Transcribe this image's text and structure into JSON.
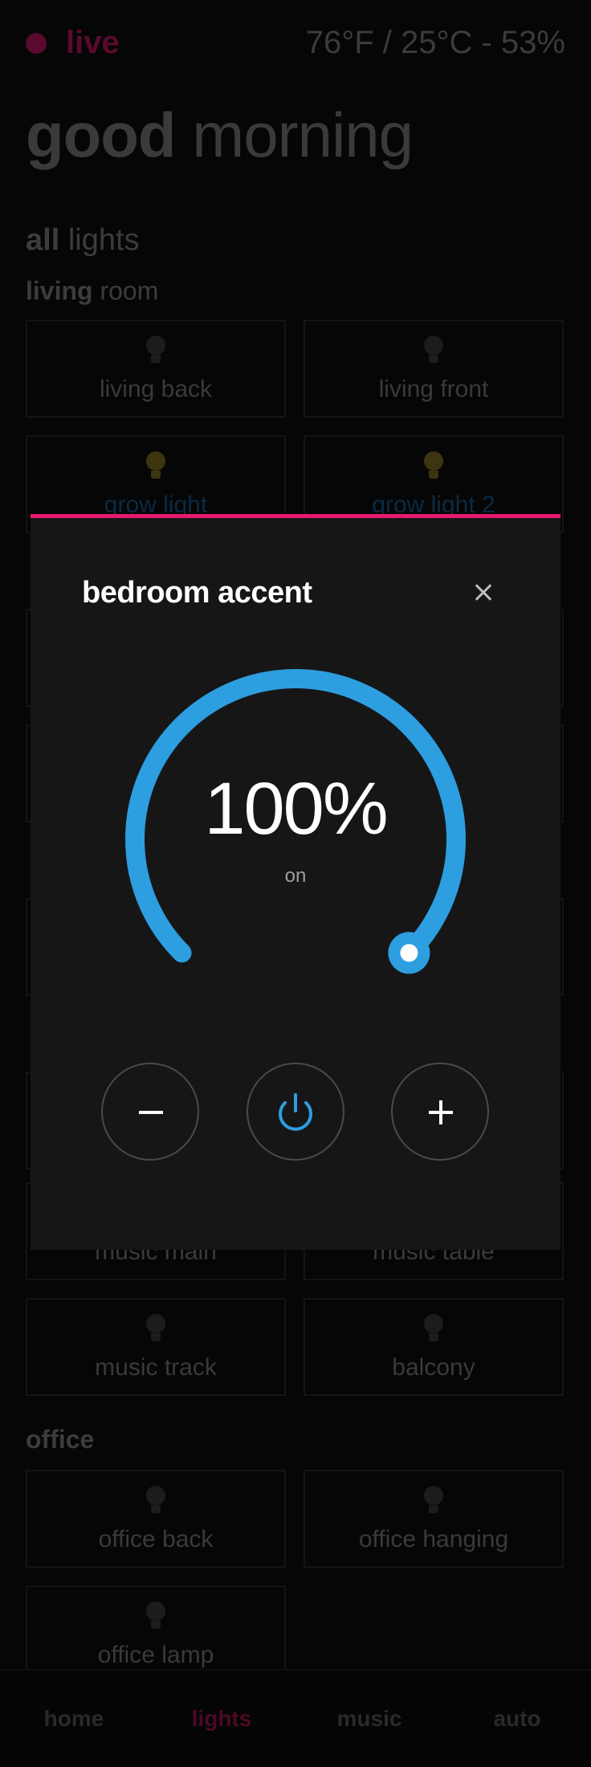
{
  "status": {
    "live_label": "live",
    "weather": "76°F / 25°C - 53%"
  },
  "greeting": {
    "bold": "good",
    "light": "morning"
  },
  "all_lights": {
    "bold": "all",
    "light": "lights"
  },
  "rooms": {
    "living": {
      "bold": "living",
      "light": "room"
    },
    "office": {
      "label": "office"
    }
  },
  "tiles": {
    "living_back": "living back",
    "living_front": "living front",
    "grow_light": "grow light",
    "grow_light_2": "grow light 2",
    "music_main": "music main",
    "music_table": "music table",
    "music_track": "music track",
    "balcony": "balcony",
    "office_back": "office back",
    "office_hanging": "office hanging",
    "office_lamp": "office lamp"
  },
  "dialog": {
    "title": "bedroom accent",
    "value": "100%",
    "state": "on",
    "level_percent": 100
  },
  "nav": {
    "home": "home",
    "lights": "lights",
    "music": "music",
    "auto": "auto",
    "active": "lights"
  },
  "colors": {
    "accent": "#e8196f",
    "dial": "#2d9ee0",
    "background": "#060606",
    "dialog_bg": "#161617"
  },
  "icons": {
    "close": "close-icon",
    "minus": "minus-icon",
    "power": "power-icon",
    "plus": "plus-icon",
    "bulb": "bulb-icon"
  }
}
